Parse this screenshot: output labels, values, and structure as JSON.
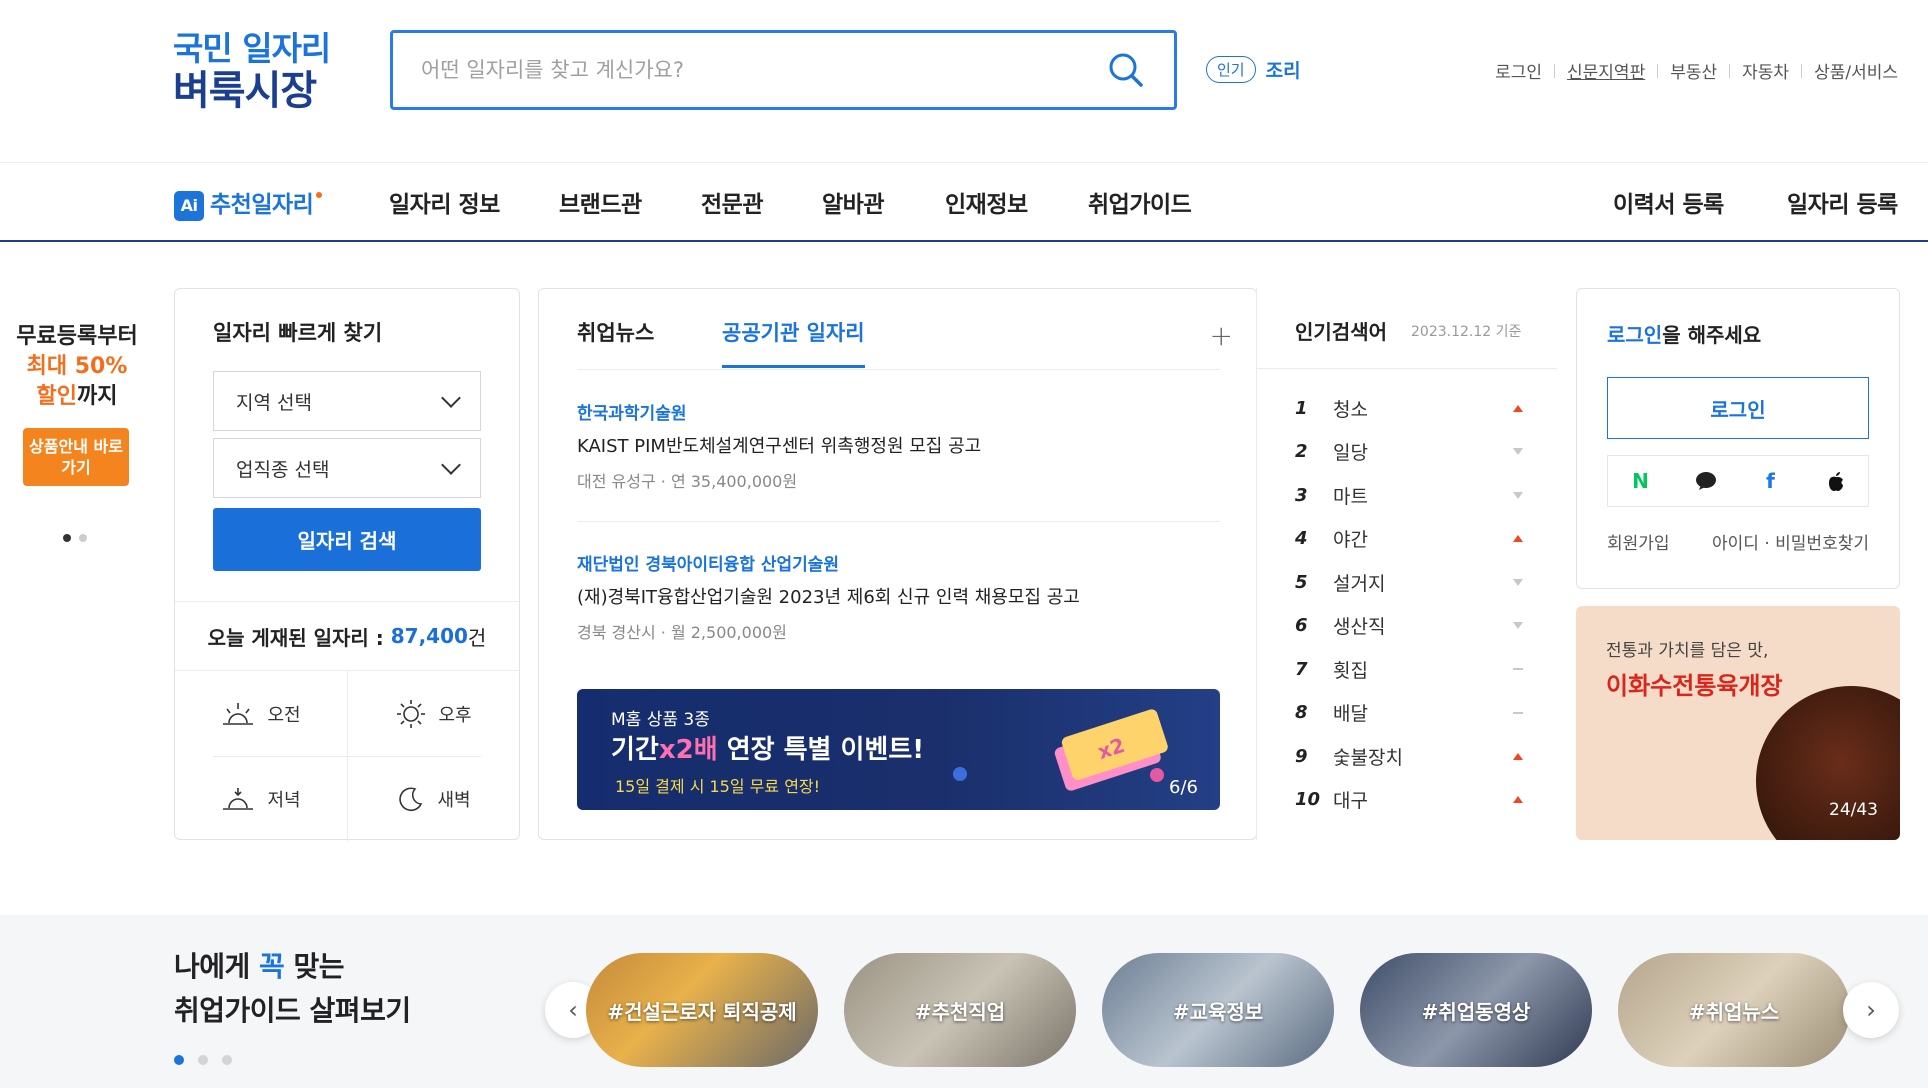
{
  "header": {
    "logo_line1": "국민 일자리",
    "logo_line2": "벼룩시장",
    "search_placeholder": "어떤 일자리를 찾고 계신가요?",
    "popular_badge": "인기",
    "popular_keyword": "조리",
    "util_links": [
      "로그인",
      "신문지역판",
      "부동산",
      "자동차",
      "상품/서비스"
    ]
  },
  "gnb": {
    "ai_badge": "Ai",
    "items": [
      "추천일자리",
      "일자리 정보",
      "브랜드관",
      "전문관",
      "알바관",
      "인재정보",
      "취업가이드"
    ],
    "right_items": [
      "이력서 등록",
      "일자리 등록"
    ]
  },
  "promo": {
    "line1": "무료등록부터",
    "line2": "최대 50%",
    "line3_highlight": "할인",
    "line3_rest": "까지",
    "button": "상품안내 바로가기"
  },
  "quick_search": {
    "title": "일자리 빠르게 찾기",
    "region_select": "지역 선택",
    "job_select": "업직종 선택",
    "search_button": "일자리 검색",
    "today_label": "오늘 게재된 일자리 :",
    "today_count": "87,400",
    "today_unit": "건",
    "times": [
      "오전",
      "오후",
      "저녁",
      "새벽"
    ]
  },
  "news": {
    "tabs": [
      "취업뉴스",
      "공공기관 일자리"
    ],
    "active_tab": 1,
    "items": [
      {
        "org": "한국과학기술원",
        "title": "KAIST PIM반도체설계연구센터 위촉행정원 모집 공고",
        "meta": "대전 유성구 · 연 35,400,000원"
      },
      {
        "org": "재단법인 경북아이티융합 산업기술원",
        "title": "(재)경북IT융합산업기술원 2023년 제6회 신규 인력 채용모집 공고",
        "meta": "경북 경산시 · 월 2,500,000원"
      }
    ],
    "banner": {
      "line1": "M홈 상품 3종",
      "line2_a": "기간",
      "line2_hl": "x2배",
      "line2_b": "연장 특별 이벤트!",
      "line3": "15일 결제 시 15일 무료 연장!",
      "pager": "6/6"
    }
  },
  "ranking": {
    "title": "인기검색어",
    "date": "2023.12.12 기준",
    "items": [
      {
        "rank": "1",
        "word": "청소",
        "trend": "up"
      },
      {
        "rank": "2",
        "word": "일당",
        "trend": "down"
      },
      {
        "rank": "3",
        "word": "마트",
        "trend": "down"
      },
      {
        "rank": "4",
        "word": "야간",
        "trend": "up"
      },
      {
        "rank": "5",
        "word": "설거지",
        "trend": "down"
      },
      {
        "rank": "6",
        "word": "생산직",
        "trend": "down"
      },
      {
        "rank": "7",
        "word": "횟집",
        "trend": "same"
      },
      {
        "rank": "8",
        "word": "배달",
        "trend": "same"
      },
      {
        "rank": "9",
        "word": "숯불장치",
        "trend": "up"
      },
      {
        "rank": "10",
        "word": "대구",
        "trend": "up"
      }
    ]
  },
  "login": {
    "prompt_highlight": "로그인",
    "prompt_rest": "을 해주세요",
    "button": "로그인",
    "sns": [
      "N",
      "💬",
      "f",
      ""
    ],
    "signup": "회원가입",
    "find": "아이디 · 비밀번호찾기"
  },
  "ad": {
    "line1": "전통과 가치를 담은 맛,",
    "line2": "이화수전통육개장",
    "pager": "24/43"
  },
  "guide": {
    "title_a": "나에게 ",
    "title_hl": "꼭",
    "title_b": " 맞는",
    "title_line2": "취업가이드 살펴보기",
    "pills": [
      "#건설근로자 퇴직공제",
      "#추천직업",
      "#교육정보",
      "#취업동영상",
      "#취업뉴스"
    ]
  },
  "colors": {
    "brand": "#1a74d9",
    "navy": "#1b3f8e",
    "orange": "#f36f1c"
  }
}
